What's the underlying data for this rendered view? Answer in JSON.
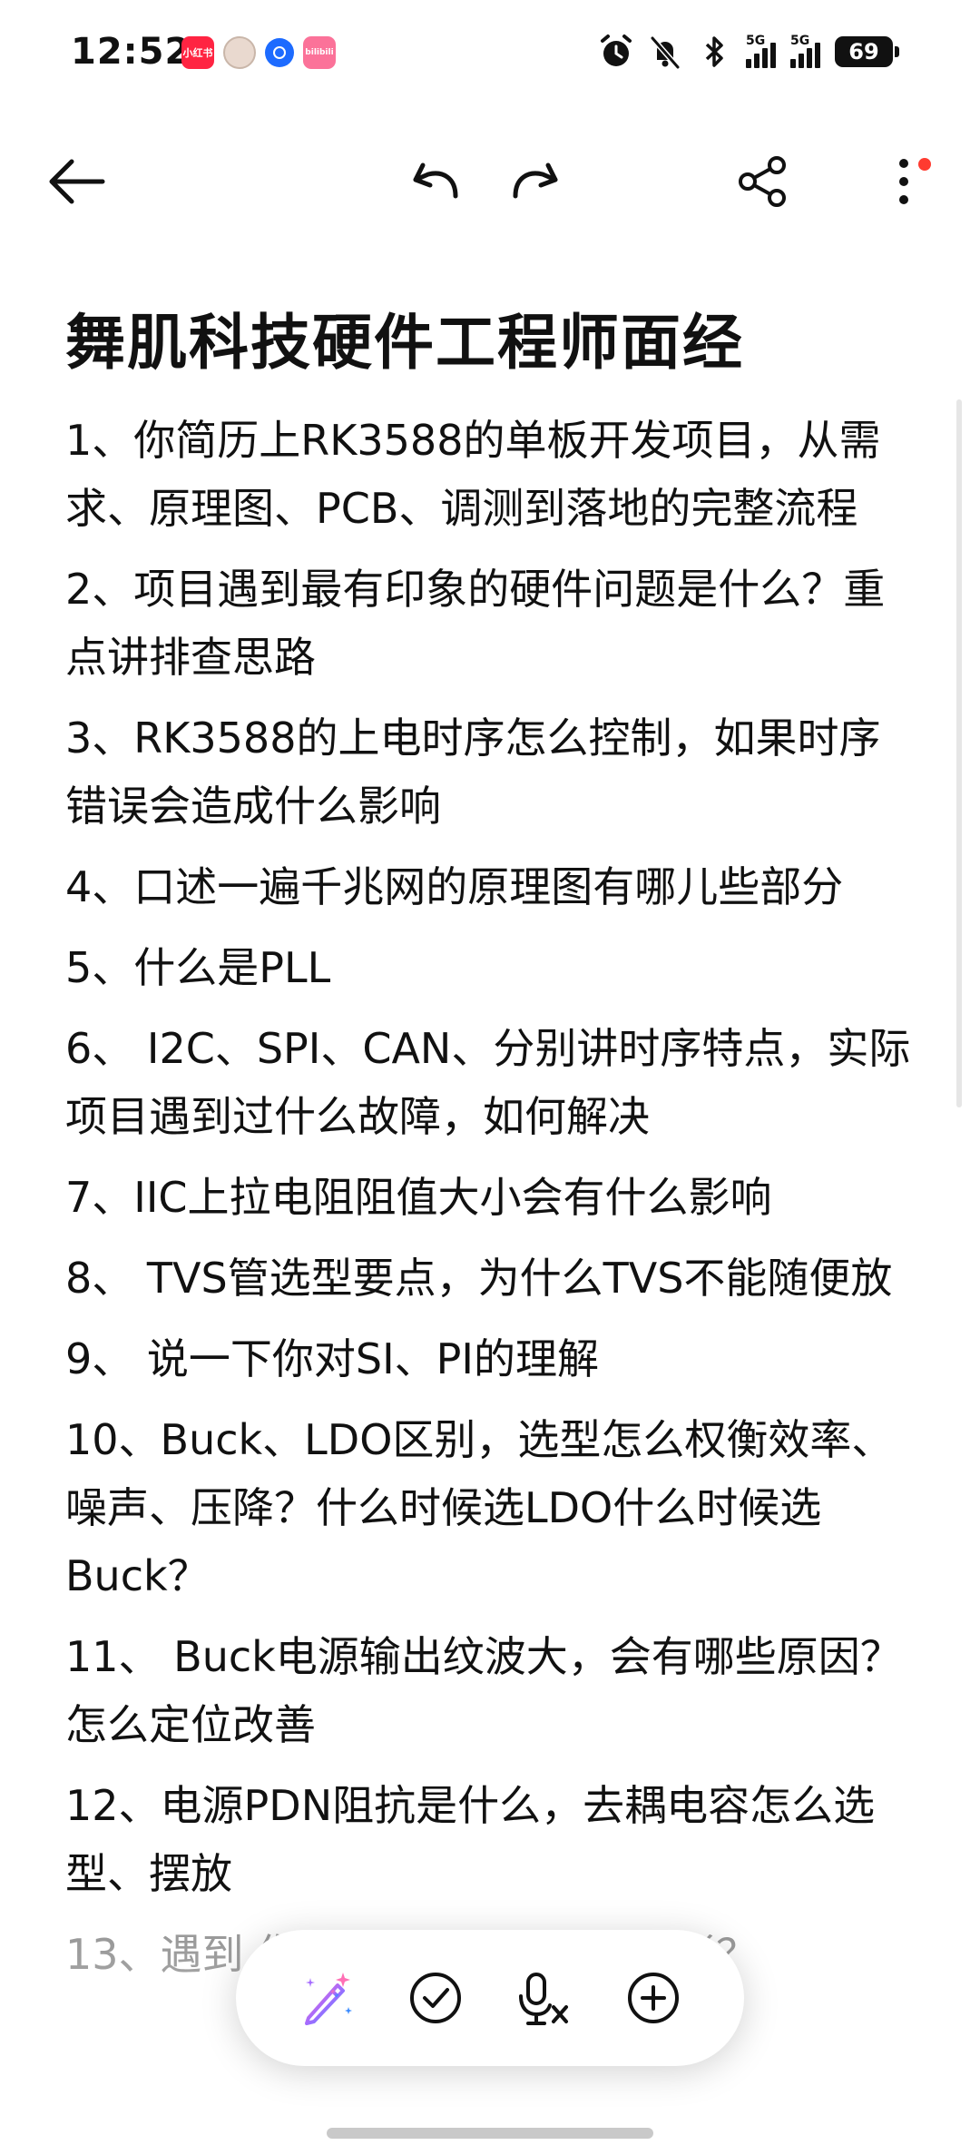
{
  "status_bar": {
    "time": "12:52",
    "notification_apps": [
      {
        "name": "xiaohongshu-app-icon",
        "label": "小红书",
        "color": "#ff2442"
      },
      {
        "name": "contact-avatar-icon",
        "label": "",
        "color": "#e9d9cf"
      },
      {
        "name": "circle-app-icon",
        "label": "",
        "color": "#1d6bff"
      },
      {
        "name": "bilibili-app-icon",
        "label": "bilibili",
        "color": "#fb7299"
      }
    ],
    "signal_1_label": "5G",
    "signal_2_label": "5G",
    "battery": "69"
  },
  "toolbar": {
    "back": "back-arrow-icon",
    "undo": "undo-icon",
    "redo": "redo-icon",
    "share": "share-icon",
    "more": "more-vertical-icon",
    "more_badge_color": "#ff3b30"
  },
  "note": {
    "title": "舞肌科技硬件工程师面经",
    "items": [
      "1、你简历上RK3588的单板开发项目，从需求、原理图、PCB、调测到落地的完整流程",
      "2、项目遇到最有印象的硬件问题是什么？重点讲排查思路",
      "3、RK3588的上电时序怎么控制，如果时序错误会造成什么影响",
      "4、口述一遍千兆网的原理图有哪儿些部分",
      "5、什么是PLL",
      "6、 I2C、SPI、CAN、分别讲时序特点，实际项目遇到过什么故障，如何解决",
      "7、IIC上拉电阻阻值大小会有什么影响",
      "8、 TVS管选型要点，为什么TVS不能随便放",
      "9、 说一下你对SI、PI的理解",
      "10、Buck、LDO区别，选型怎么权衡效率、噪声、压降？什么时候选LDO什么时候选Buck？",
      "11、 Buck电源输出纹波大，会有哪些原因？怎么定位改善",
      "12、电源PDN阻抗是什么，去耦电容怎么选型、摆放",
      "13、遇到                          你怎么用仪器抓异常波形？"
    ]
  },
  "floating_bar": {
    "ai_write": "magic-pen-icon",
    "checklist": "checkmark-circle-icon",
    "voice": "voice-to-text-icon",
    "add": "add-circle-icon"
  }
}
